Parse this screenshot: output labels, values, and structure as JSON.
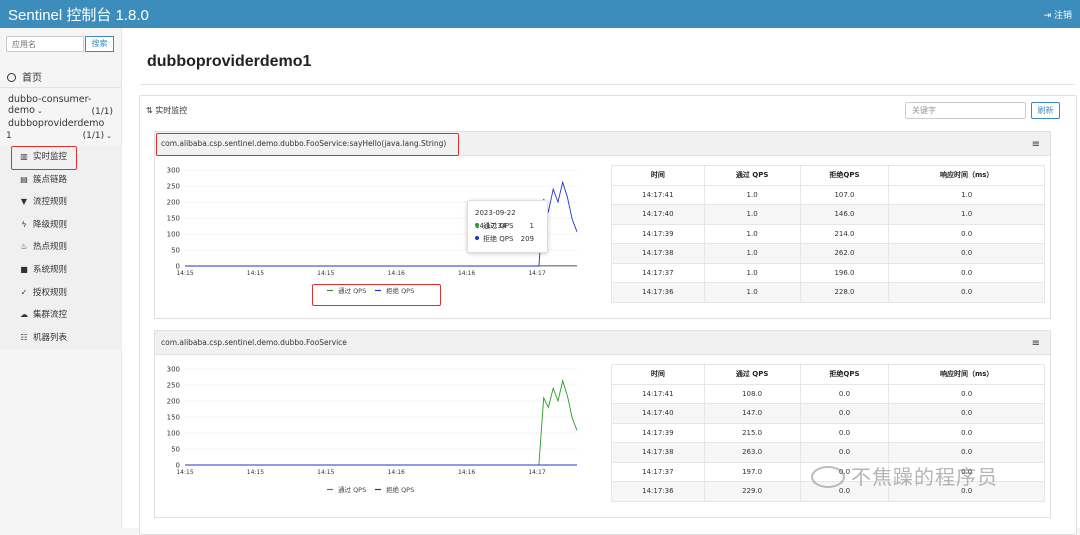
{
  "header": {
    "title": "Sentinel 控制台 1.8.0",
    "logout": "注销"
  },
  "sidebar": {
    "search_placeholder": "应用名",
    "search_button": "搜索",
    "home": "首页",
    "apps": [
      {
        "name": "dubbo-consumer-demo",
        "count": "(1/1)"
      },
      {
        "name": "dubboproviderdemo",
        "name_suffix": "1",
        "count": "(1/1)"
      }
    ],
    "menu": [
      {
        "label": "实时监控",
        "icon": "bar-chart-icon"
      },
      {
        "label": "簇点链路",
        "icon": "list-icon"
      },
      {
        "label": "流控规则",
        "icon": "filter-icon"
      },
      {
        "label": "降级规则",
        "icon": "bolt-icon"
      },
      {
        "label": "热点规则",
        "icon": "fire-icon"
      },
      {
        "label": "系统规则",
        "icon": "lock-icon"
      },
      {
        "label": "授权规则",
        "icon": "check-circle-icon"
      },
      {
        "label": "集群流控",
        "icon": "cloud-icon"
      },
      {
        "label": "机器列表",
        "icon": "table-icon"
      }
    ]
  },
  "main": {
    "page_title": "dubboproviderdemo1",
    "panel_title": "实时监控",
    "keyword_placeholder": "关键字",
    "refresh_button": "刷新",
    "table_headers": [
      "时间",
      "通过 QPS",
      "拒绝QPS",
      "响应时间（ms）"
    ],
    "cards": [
      {
        "resource": "com.alibaba.csp.sentinel.demo.dubbo.FooService:sayHello(java.lang.String)",
        "rows": [
          [
            "14:17:41",
            "1.0",
            "107.0",
            "1.0"
          ],
          [
            "14:17:40",
            "1.0",
            "146.0",
            "1.0"
          ],
          [
            "14:17:39",
            "1.0",
            "214.0",
            "0.0"
          ],
          [
            "14:17:38",
            "1.0",
            "262.0",
            "0.0"
          ],
          [
            "14:17:37",
            "1.0",
            "196.0",
            "0.0"
          ],
          [
            "14:17:36",
            "1.0",
            "228.0",
            "0.0"
          ]
        ],
        "tooltip": {
          "time": "2023-09-22 14:17:34",
          "pass_label": "通过 QPS",
          "pass_value": "1",
          "block_label": "拒绝 QPS",
          "block_value": "209"
        }
      },
      {
        "resource": "com.alibaba.csp.sentinel.demo.dubbo.FooService",
        "rows": [
          [
            "14:17:41",
            "108.0",
            "0.0",
            "0.0"
          ],
          [
            "14:17:40",
            "147.0",
            "0.0",
            "0.0"
          ],
          [
            "14:17:39",
            "215.0",
            "0.0",
            "0.0"
          ],
          [
            "14:17:38",
            "263.0",
            "0.0",
            "0.0"
          ],
          [
            "14:17:37",
            "197.0",
            "0.0",
            "0.0"
          ],
          [
            "14:17:36",
            "229.0",
            "0.0",
            "0.0"
          ]
        ]
      }
    ],
    "watermark": "不焦躁的程序员"
  },
  "chart_data": [
    {
      "type": "line",
      "x": [
        "14:15",
        "14:15",
        "14:15",
        "14:16",
        "14:16",
        "14:17"
      ],
      "yticks": [
        0,
        50,
        100,
        150,
        200,
        250,
        300
      ],
      "ylim": [
        0,
        300
      ],
      "series": [
        {
          "name": "通过 QPS",
          "color": "#2a9a2a",
          "values": [
            0,
            0,
            0,
            0,
            0,
            0,
            1,
            1,
            1,
            1,
            1,
            1,
            1,
            1
          ]
        },
        {
          "name": "拒绝 QPS",
          "color": "#2233cc",
          "values": [
            0,
            0,
            0,
            0,
            0,
            0,
            0,
            209,
            170,
            240,
            200,
            262,
            214,
            146,
            107
          ]
        }
      ]
    },
    {
      "type": "line",
      "x": [
        "14:15",
        "14:15",
        "14:15",
        "14:16",
        "14:16",
        "14:17"
      ],
      "yticks": [
        0,
        50,
        100,
        150,
        200,
        250,
        300
      ],
      "ylim": [
        0,
        300
      ],
      "series": [
        {
          "name": "通过 QPS",
          "color": "#2a9a2a",
          "values": [
            0,
            0,
            0,
            0,
            0,
            0,
            0,
            210,
            180,
            240,
            200,
            263,
            215,
            147,
            108
          ]
        },
        {
          "name": "拒绝 QPS",
          "color": "#2233cc",
          "values": [
            0,
            0,
            0,
            0,
            0,
            0,
            0,
            0,
            0,
            0,
            0,
            0,
            0,
            0,
            0
          ]
        }
      ]
    }
  ]
}
